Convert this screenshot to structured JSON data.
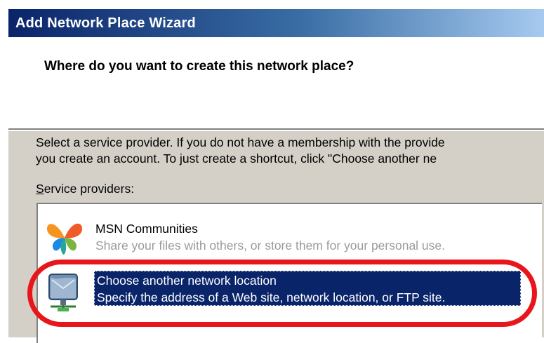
{
  "window": {
    "title": "Add Network Place Wizard"
  },
  "header": {
    "title": "Where do you want to create this network place?"
  },
  "description": {
    "line1": "Select a service provider.  If you do not have a membership with the provide",
    "line2": "you create an account.  To just create a shortcut, click \"Choose another ne"
  },
  "providers": {
    "label_underlined": "S",
    "label_rest": "ervice providers:",
    "items": [
      {
        "name": "MSN Communities",
        "description": "Share your files with others, or store them for your personal use.",
        "icon": "msn-butterfly-icon",
        "selected": false
      },
      {
        "name": "Choose another network location",
        "description": "Specify the address of a Web site, network location, or FTP site.",
        "icon": "network-location-icon",
        "selected": true
      }
    ]
  },
  "colors": {
    "selection": "#0a246a",
    "highlight_ring": "#e8151b",
    "dialog_face": "#d4d0c8"
  }
}
